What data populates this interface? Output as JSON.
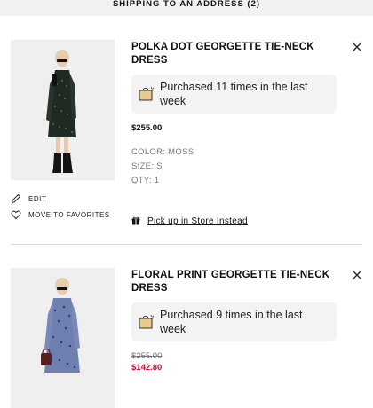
{
  "header": {
    "title": "SHIPPING TO AN ADDRESS (2)"
  },
  "items": [
    {
      "title": "POLKA DOT GEORGETTE TIE-NECK DRESS",
      "badge_text": "Purchased 11 times in the last week",
      "price": "$255.00",
      "color": "COLOR: MOSS",
      "size": "SIZE: S",
      "qty": "QTY: 1",
      "edit_label": "EDIT",
      "favorites_label": "MOVE TO FAVORITES",
      "pickup_label": "Pick up in Store Instead"
    },
    {
      "title": "FLORAL PRINT GEORGETTE TIE-NECK DRESS",
      "badge_text": "Purchased 9 times in the last week",
      "price_original": "$255.00",
      "price_sale": "$142.80"
    }
  ],
  "colors": {
    "sale": "#c8102e",
    "badge_bg": "#f3f3f3",
    "header_bg": "#f2f2f2"
  },
  "icons": [
    "close-icon",
    "shopping-bag-icon",
    "pencil-icon",
    "heart-icon",
    "gift-icon"
  ]
}
